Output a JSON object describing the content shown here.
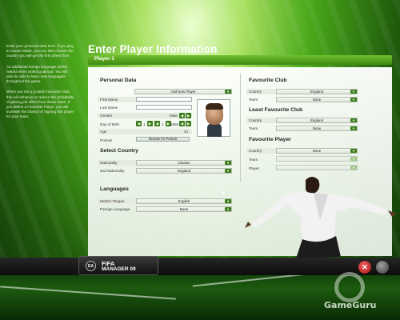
{
  "left_info": [
    "Enter your personal data here. If you play in Career Mode, you can also choose the country you will get the first offers from.",
    "An additional foreign language will be helpful when working abroad. You will also be able to learn new languages throughout the game.",
    "When you set a (Least) Favourite Club, this will enhance or reduce the probability of getting job offers from those clubs. If you define a Favourite Player, you will increase the chance of signing this player for your team."
  ],
  "title": "Enter Player Information",
  "player_tab": "Player 1",
  "personal": {
    "heading": "Personal Data",
    "add_player": "Add New Player",
    "first_name_label": "First Name",
    "first_name_value": "",
    "last_name_label": "Last Name",
    "last_name_value": "",
    "gender_label": "Gender",
    "gender_value": "Male",
    "dob_label": "Day of Birth",
    "dob_day": "1",
    "dob_month": "1",
    "dob_year": "1984",
    "age_label": "Age",
    "age_value": "24",
    "portrait_label": "Portrait",
    "browse_label": "Browse for Portrait"
  },
  "country": {
    "heading": "Select Country",
    "nationality_label": "Nationality",
    "nationality_value": "Ukraine",
    "second_label": "2nd Nationality",
    "second_value": "England"
  },
  "languages": {
    "heading": "Languages",
    "mother_label": "Mother Tongue",
    "mother_value": "English",
    "foreign_label": "Foreign Language",
    "foreign_value": "None"
  },
  "fav_club": {
    "heading": "Favourite Club",
    "country_label": "Country",
    "country_value": "England",
    "team_label": "Team",
    "team_value": "None"
  },
  "least_club": {
    "heading": "Least Favourite Club",
    "country_label": "Country",
    "country_value": "England",
    "team_label": "Team",
    "team_value": "None"
  },
  "fav_player": {
    "heading": "Favourite Player",
    "country_label": "Country",
    "country_value": "None",
    "team_label": "Team",
    "team_value": "",
    "player_label": "Player",
    "player_value": ""
  },
  "logo": {
    "ea": "EA",
    "line1": "FIFA",
    "line2": "MANAGER 09"
  },
  "close_symbol": "✕",
  "watermark": "GameGuru",
  "colors": {
    "accent": "#3c7d1a",
    "bar": "#5aaa22",
    "close": "#c01818"
  }
}
